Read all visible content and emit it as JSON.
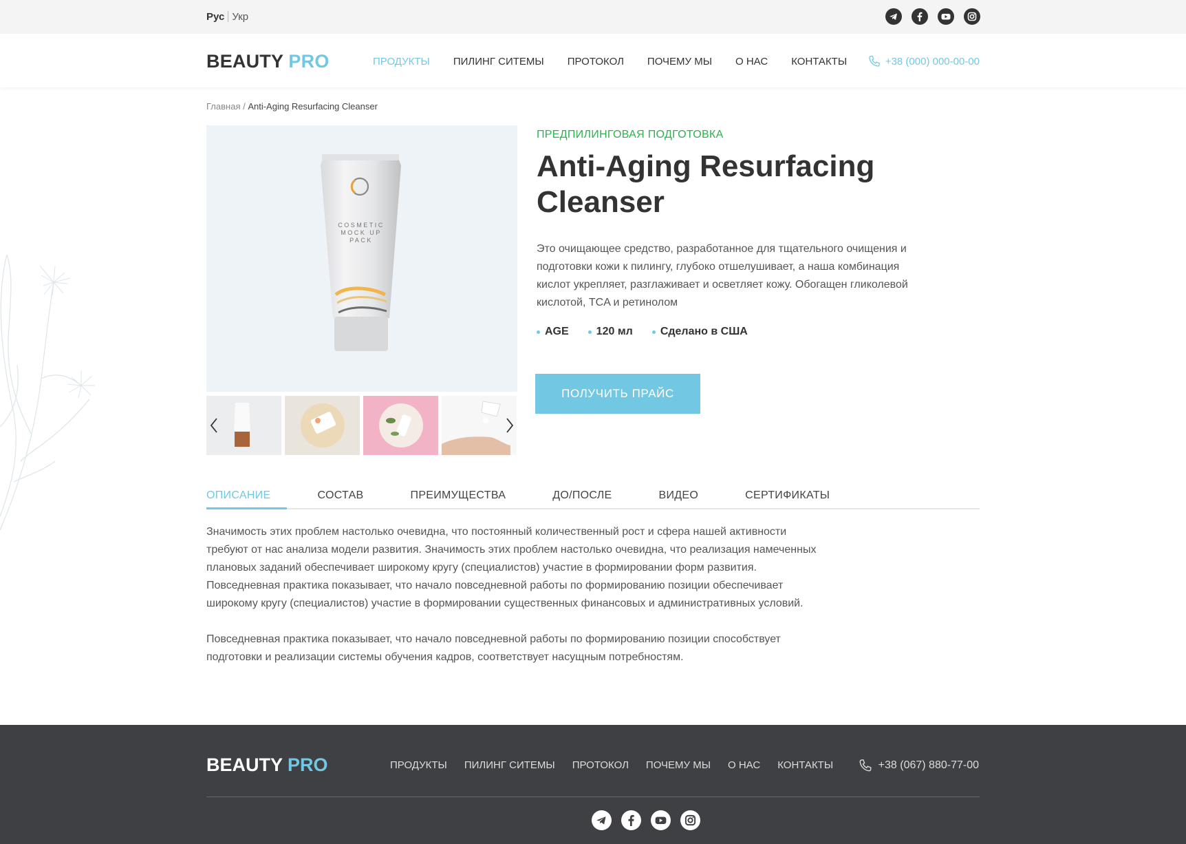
{
  "lang": {
    "active": "Рус",
    "other": "Укр"
  },
  "logo": {
    "beauty": "BEAUTY",
    "pro": "PRO"
  },
  "nav": [
    "ПРОДУКТЫ",
    "ПИЛИНГ СИТЕМЫ",
    "ПРОТОКОЛ",
    "ПОЧЕМУ МЫ",
    "О НАС",
    "КОНТАКТЫ"
  ],
  "phone_top": "+38 (000) 000-00-00",
  "breadcrumb": {
    "home": "Главная",
    "sep": " / ",
    "current": "Anti-Aging Resurfacing Cleanser"
  },
  "product": {
    "category": "ПРЕДПИЛИНГОВАЯ ПОДГОТОВКА",
    "title": "Anti-Aging Resurfacing Cleanser",
    "description": "Это очищающее средство, разработанное для тщательного очищения и подготовки кожи к пилингу, глубоко отшелушивает, а наша комбинация кислот укрепляет, разглаживает и осветляет кожу.  Обогащен гликолевой кислотой, TCA и ретинолом",
    "specs": [
      "AGE",
      "120 мл",
      "Сделано в США"
    ],
    "cta": "ПОЛУЧИТЬ ПРАЙС",
    "tube_text": [
      "COSMETIC",
      "MOCK UP",
      "PACK"
    ]
  },
  "tabs": [
    "ОПИСАНИЕ",
    "СОСТАВ",
    "ПРЕИМУЩЕСТВА",
    "ДО/ПОСЛЕ",
    "ВИДЕО",
    "СЕРТИФИКАТЫ"
  ],
  "content": {
    "p1": "Значимость этих проблем настолько очевидна, что постоянный количественный рост и сфера нашей активности требуют от нас анализа модели развития. Значимость этих проблем настолько очевидна, что реализация намеченных плановых заданий обеспечивает широкому кругу (специалистов) участие в формировании форм развития. Повседневная практика показывает, что начало повседневной работы по формированию позиции обеспечивает широкому кругу (специалистов) участие в формировании существенных финансовых и административных условий.",
    "p2": "Повседневная практика показывает, что начало повседневной работы по формированию позиции способствует подготовки и реализации системы обучения кадров, соответствует насущным потребностям."
  },
  "footer": {
    "nav": [
      "ПРОДУКТЫ",
      "ПИЛИНГ СИТЕМЫ",
      "ПРОТОКОЛ",
      "ПОЧЕМУ МЫ",
      "О НАС",
      "КОНТАКТЫ"
    ],
    "phone": "+38 (067) 880-77-00"
  },
  "colors": {
    "accent": "#72c8e3",
    "category": "#2bb24c",
    "footer_bg": "#3e4043"
  },
  "icons": [
    "telegram-icon",
    "facebook-icon",
    "youtube-icon",
    "instagram-icon",
    "phone-icon"
  ]
}
